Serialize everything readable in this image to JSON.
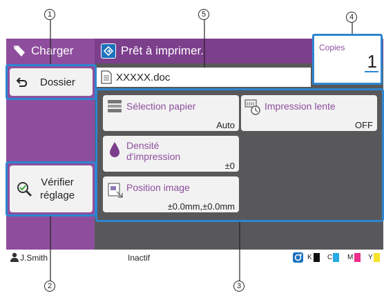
{
  "topbar": {
    "mode_tab_label": "Charger",
    "status_text": "Prêt à imprimer.",
    "copies_label": "Copies",
    "copies_value": "1"
  },
  "file": {
    "name": "XXXXX.doc"
  },
  "left_panel": {
    "folder_button": "Dossier",
    "check_button_line1": "Vérifier",
    "check_button_line2": "réglage"
  },
  "functions": [
    {
      "label": "Sélection papier",
      "value": "Auto",
      "icon": "paper-tray-icon"
    },
    {
      "label": "Impression lente",
      "value": "OFF",
      "icon": "slow-print-icon"
    },
    {
      "label_line1": "Densité",
      "label_line2": "d'impression",
      "value": "±0",
      "icon": "ink-drop-icon"
    },
    {
      "label": "Position image",
      "value": "±0.0mm,±0.0mm",
      "icon": "image-position-icon"
    }
  ],
  "status_bar": {
    "user": "J.Smith",
    "state": "Inactif",
    "ink": [
      {
        "label": "K",
        "color": "#111111"
      },
      {
        "label": "C",
        "color": "#29abe2"
      },
      {
        "label": "M",
        "color": "#ec2d8c"
      },
      {
        "label": "Y",
        "color": "#f5e32a"
      }
    ]
  },
  "callouts": [
    "1",
    "2",
    "3",
    "4",
    "5"
  ],
  "colors": {
    "accent": "#8e4e9d",
    "highlight": "#2d86d1",
    "panel": "#58585a"
  }
}
